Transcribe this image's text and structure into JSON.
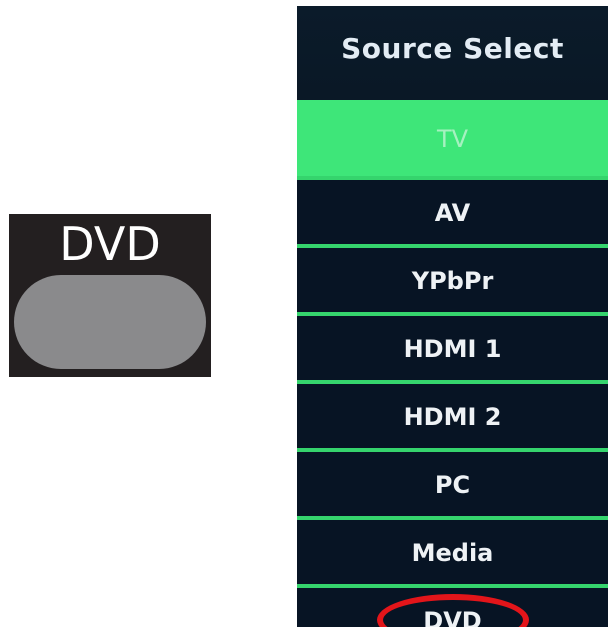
{
  "remote": {
    "key_label": "DVD"
  },
  "menu": {
    "title": "Source Select",
    "items": [
      {
        "label": "TV",
        "selected": true
      },
      {
        "label": "AV"
      },
      {
        "label": "YPbPr"
      },
      {
        "label": "HDMI 1"
      },
      {
        "label": "HDMI 2"
      },
      {
        "label": "PC"
      },
      {
        "label": "Media"
      },
      {
        "label": "DVD",
        "circled": true
      }
    ]
  },
  "colors": {
    "highlight": "#3ee679",
    "divider": "#35d46d",
    "circle": "#e3151a",
    "key_body": "#231f20",
    "key_button": "#8a8a8c"
  }
}
